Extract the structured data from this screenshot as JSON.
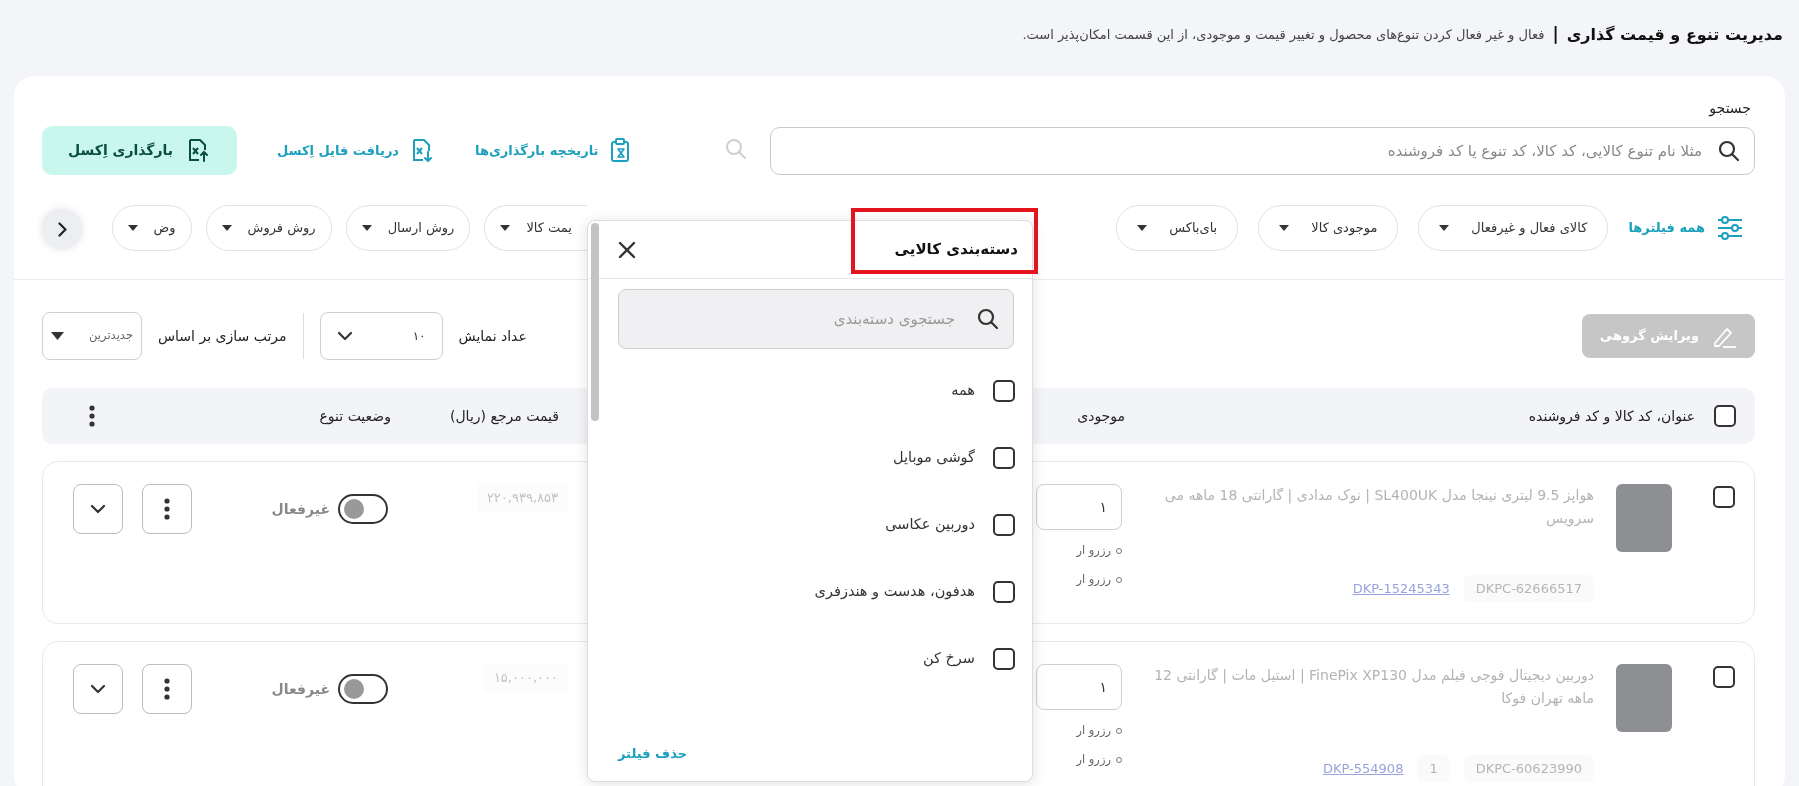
{
  "header": {
    "title": "مدیریت تنوع و قیمت گذاری",
    "separator": "|",
    "description": "فعال و غیر فعال کردن تنوع‌های محصول و تغییر قیمت و موجودی، از این قسمت امکان‌پذیر است."
  },
  "search": {
    "label": "جستجو",
    "placeholder": "مثلا نام تنوع کالایی، کد کالا، کد تنوع یا کد فروشنده"
  },
  "actions": [
    {
      "kind": "history",
      "label": "تاریخچه بارگذاری‌ها"
    },
    {
      "kind": "download",
      "label": "دریافت فایل اِکسل"
    },
    {
      "kind": "upload",
      "label": "بارگذاری اِکسل"
    }
  ],
  "filters": {
    "all_label": "همه فیلترها",
    "chips": [
      {
        "label": "کالای فعال و غیرفعال"
      },
      {
        "label": "موجودی کالا"
      },
      {
        "label": "بای‌باکس"
      },
      {
        "label": "یمت کالا"
      },
      {
        "label": "روش ارسال"
      },
      {
        "label": "روش فروش"
      },
      {
        "label": "وض"
      }
    ]
  },
  "toolbar": {
    "bulk_edit": {
      "label": "ویرایش گروهی",
      "disabled": true
    },
    "page_size_label": "عداد نمایش",
    "page_size": "۱۰",
    "sort_label": "مرتب سازی بر اساس",
    "sort": "جدیدترین"
  },
  "table": {
    "checked": false,
    "columns": [
      "عنوان، کد کالا و کد فروشنده",
      "موجودی",
      "قیمت مرجع (ریال)",
      "وضعیت تنوع"
    ],
    "rows": [
      {
        "checked": false,
        "title": "هواپز 9.5 لیتری نینجا مدل SL400UK | نوک مدادی | گارانتی 18 ماهه می سرویس",
        "codes": [
          {
            "kind": "variant",
            "text": "DKPC-62666517"
          },
          {
            "kind": "product",
            "text": "DKP-15245343"
          }
        ],
        "stock": "۱",
        "reserve": [
          "رزرو ار",
          "رزرو ار"
        ],
        "price": "۲۲۰,۹۳۹,۸۵۳",
        "active": false,
        "status": "غیرفعال"
      },
      {
        "checked": false,
        "title": "دوربین دیجیتال فوجی فیلم مدل FinePix XP130 | استیل مات | گارانتی 12 ماهه تهران فوکا",
        "codes": [
          {
            "kind": "variant",
            "text": "DKPC-60623990"
          },
          {
            "kind": "count",
            "text": "1"
          },
          {
            "kind": "product",
            "text": "DKP-554908"
          }
        ],
        "stock": "۱",
        "reserve": [
          "رزرو ار",
          "رزرو ار"
        ],
        "price": "۱۵,۰۰۰,۰۰۰",
        "active": false,
        "status": "غیرفعال"
      }
    ]
  },
  "category_filter": {
    "title": "دسته‌بندی کالایی",
    "search_placeholder": "جستجوی دسته‌بندی",
    "options": [
      {
        "label": "همه",
        "checked": false
      },
      {
        "label": "گوشی موبایل",
        "checked": false
      },
      {
        "label": "دوربین عکاسی",
        "checked": false
      },
      {
        "label": "هدفون، هدست و هندزفری",
        "checked": false
      },
      {
        "label": "سرخ کن",
        "checked": false
      }
    ],
    "clear_label": "حذف فیلتر"
  }
}
